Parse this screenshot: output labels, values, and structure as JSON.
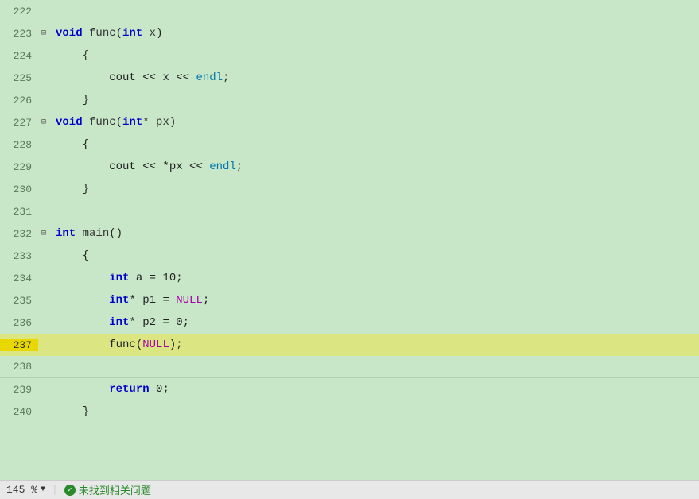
{
  "editor": {
    "background": "#c8e6c8",
    "lines": [
      {
        "num": "222",
        "content": "",
        "type": "empty"
      },
      {
        "num": "223",
        "content": "void func(int x)",
        "type": "func_decl",
        "collapse": true,
        "kw": "void",
        "func": "func",
        "param_kw": "int",
        "param": " x"
      },
      {
        "num": "224",
        "content": "    {",
        "type": "brace_open"
      },
      {
        "num": "225",
        "content": "        cout << x << endl;",
        "type": "code_body"
      },
      {
        "num": "226",
        "content": "    }",
        "type": "brace_close"
      },
      {
        "num": "227",
        "content": "void func(int* px)",
        "type": "func_decl2",
        "collapse": true,
        "kw": "void",
        "func": "func",
        "param_kw": "int*",
        "param": " px"
      },
      {
        "num": "228",
        "content": "    {",
        "type": "brace_open"
      },
      {
        "num": "229",
        "content": "        cout << *px << endl;",
        "type": "code_body"
      },
      {
        "num": "230",
        "content": "    }",
        "type": "brace_close"
      },
      {
        "num": "231",
        "content": "",
        "type": "empty"
      },
      {
        "num": "232",
        "content": "int main()",
        "type": "main_decl",
        "collapse": true,
        "kw": "int",
        "func": "main"
      },
      {
        "num": "233",
        "content": "    {",
        "type": "brace_open"
      },
      {
        "num": "234",
        "content": "        int a = 10;",
        "type": "code_body"
      },
      {
        "num": "235",
        "content": "        int* p1 = NULL;",
        "type": "code_body"
      },
      {
        "num": "236",
        "content": "        int* p2 = 0;",
        "type": "code_body"
      },
      {
        "num": "237",
        "content": "        func(NULL);",
        "type": "code_body",
        "highlight": true
      },
      {
        "num": "238",
        "content": "",
        "type": "empty_divider"
      },
      {
        "num": "239",
        "content": "        return 0;",
        "type": "code_body"
      },
      {
        "num": "240",
        "content": "    }",
        "type": "brace_close_main"
      }
    ]
  },
  "status_bar": {
    "zoom": "145 %",
    "zoom_arrow": "▼",
    "status_icon": "✓",
    "status_text": "未找到相关问题"
  }
}
